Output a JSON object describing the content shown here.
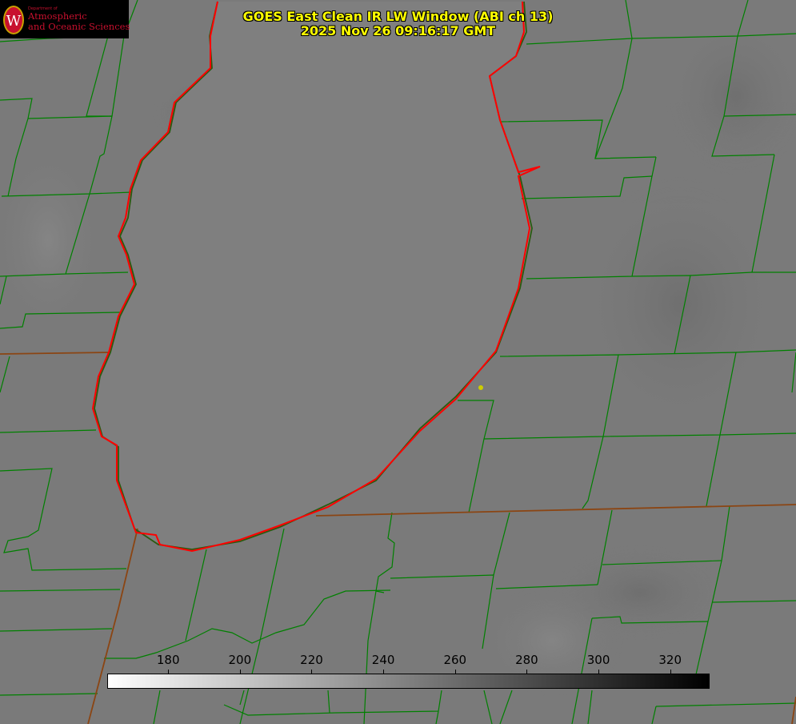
{
  "title": {
    "line1": "GOES East Clean IR LW Window (ABI ch 13)",
    "line2": "2025 Nov 26 09:16:17 GMT"
  },
  "logo": {
    "dept": "Department of",
    "line1": "Atmospheric",
    "line2": "and Oceanic Sciences",
    "crest_letter": "W"
  },
  "colorbar": {
    "ticks": [
      "180",
      "200",
      "220",
      "240",
      "260",
      "280",
      "300",
      "320"
    ],
    "range": [
      163,
      331
    ],
    "colors": {
      "low": "#ffffff",
      "high": "#000000"
    }
  },
  "map": {
    "feature": "Lake Michigan",
    "colors": {
      "county_lines": "#008000",
      "state_lines": "#8b4513",
      "coastline": "#ff0000",
      "marker": "#cccc00",
      "background": "#7a7a7a"
    }
  }
}
